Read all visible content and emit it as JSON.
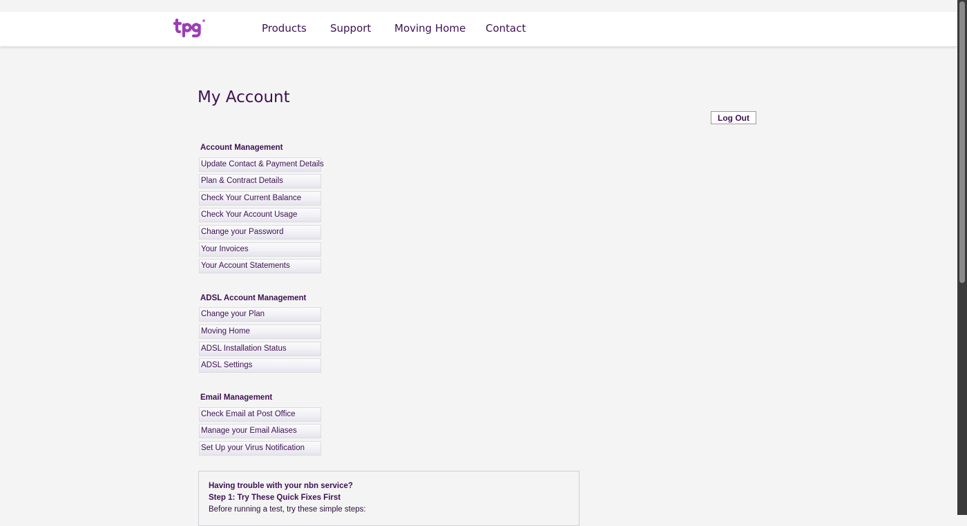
{
  "header": {
    "logo_text": "tpg",
    "nav": [
      "Products",
      "Support",
      "Moving Home",
      "Contact"
    ]
  },
  "page": {
    "title": "My Account",
    "logout_label": "Log Out"
  },
  "sections": [
    {
      "title": "Account Management",
      "items": [
        "Update Contact & Payment Details",
        "Plan & Contract Details",
        "Check Your Current Balance",
        "Check Your Account Usage",
        "Change your Password",
        "Your Invoices",
        "Your Account Statements"
      ]
    },
    {
      "title": "ADSL Account Management",
      "items": [
        "Change your Plan",
        "Moving Home",
        "ADSL Installation Status",
        "ADSL Settings"
      ]
    },
    {
      "title": "Email Management",
      "items": [
        "Check Email at Post Office",
        "Manage your Email Aliases",
        "Set Up your Virus Notification"
      ]
    }
  ],
  "help_box": {
    "heading": "Having trouble with your nbn service?",
    "step": "Step 1: Try These Quick Fixes First",
    "intro": "Before running a test, try these simple steps:"
  },
  "colors": {
    "brand_purple": "#3d1152",
    "logo_purple": "#9b3fb5",
    "background": "#f4f4f4"
  }
}
